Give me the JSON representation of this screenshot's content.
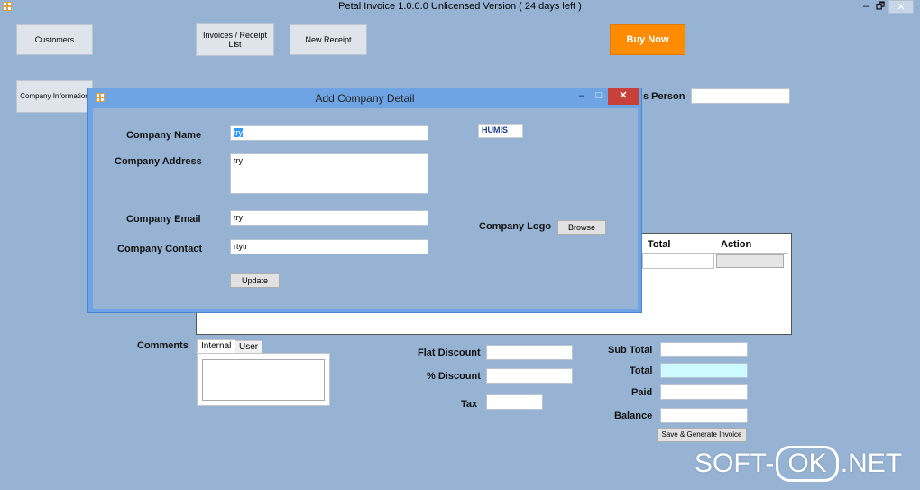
{
  "window": {
    "title": "Petal Invoice 1.0.0.0 Unlicensed Version ( 24 days left )",
    "min_glyph": "–",
    "max_glyph": "🗗",
    "close_glyph": "✕"
  },
  "toolbar": {
    "customers": "Customers",
    "invoices": "Invoices / Receipt List",
    "new_receipt": "New Receipt",
    "buy_now": "Buy Now",
    "company_info": "Company Information"
  },
  "background": {
    "sales_person_label": "s Person",
    "grid": {
      "columns": [
        "Total",
        "Action"
      ]
    },
    "comments_label": "Comments",
    "tabs": [
      "Internal",
      "User"
    ],
    "flat_discount_label": "Flat Discount",
    "percent_discount_label": "% Discount",
    "tax_label": "Tax",
    "sub_total_label": "Sub Total",
    "total_label": "Total",
    "paid_label": "Paid",
    "balance_label": "Balance",
    "save_button": "Save & Generate Invoice"
  },
  "dialog": {
    "title": "Add Company Detail",
    "company_name_label": "Company Name",
    "company_name_value": "try",
    "company_address_label": "Company Address",
    "company_address_value": "try",
    "company_email_label": "Company Email",
    "company_email_value": "try",
    "company_contact_label": "Company Contact",
    "company_contact_value": "rtytr",
    "update_button": "Update",
    "logo_text": "HUMIS",
    "company_logo_label": "Company Logo",
    "browse_button": "Browse",
    "min_glyph": "–",
    "max_glyph": "□",
    "close_glyph": "✕"
  },
  "watermark": {
    "left": "SOFT-",
    "middle": "OK",
    "right": ".NET"
  },
  "colors": {
    "background": "#97b3d3",
    "buy_now": "#ff8c00",
    "total_field": "#ccfaff",
    "dialog_border": "#6ea4e4",
    "dialog_close": "#c7403a"
  }
}
